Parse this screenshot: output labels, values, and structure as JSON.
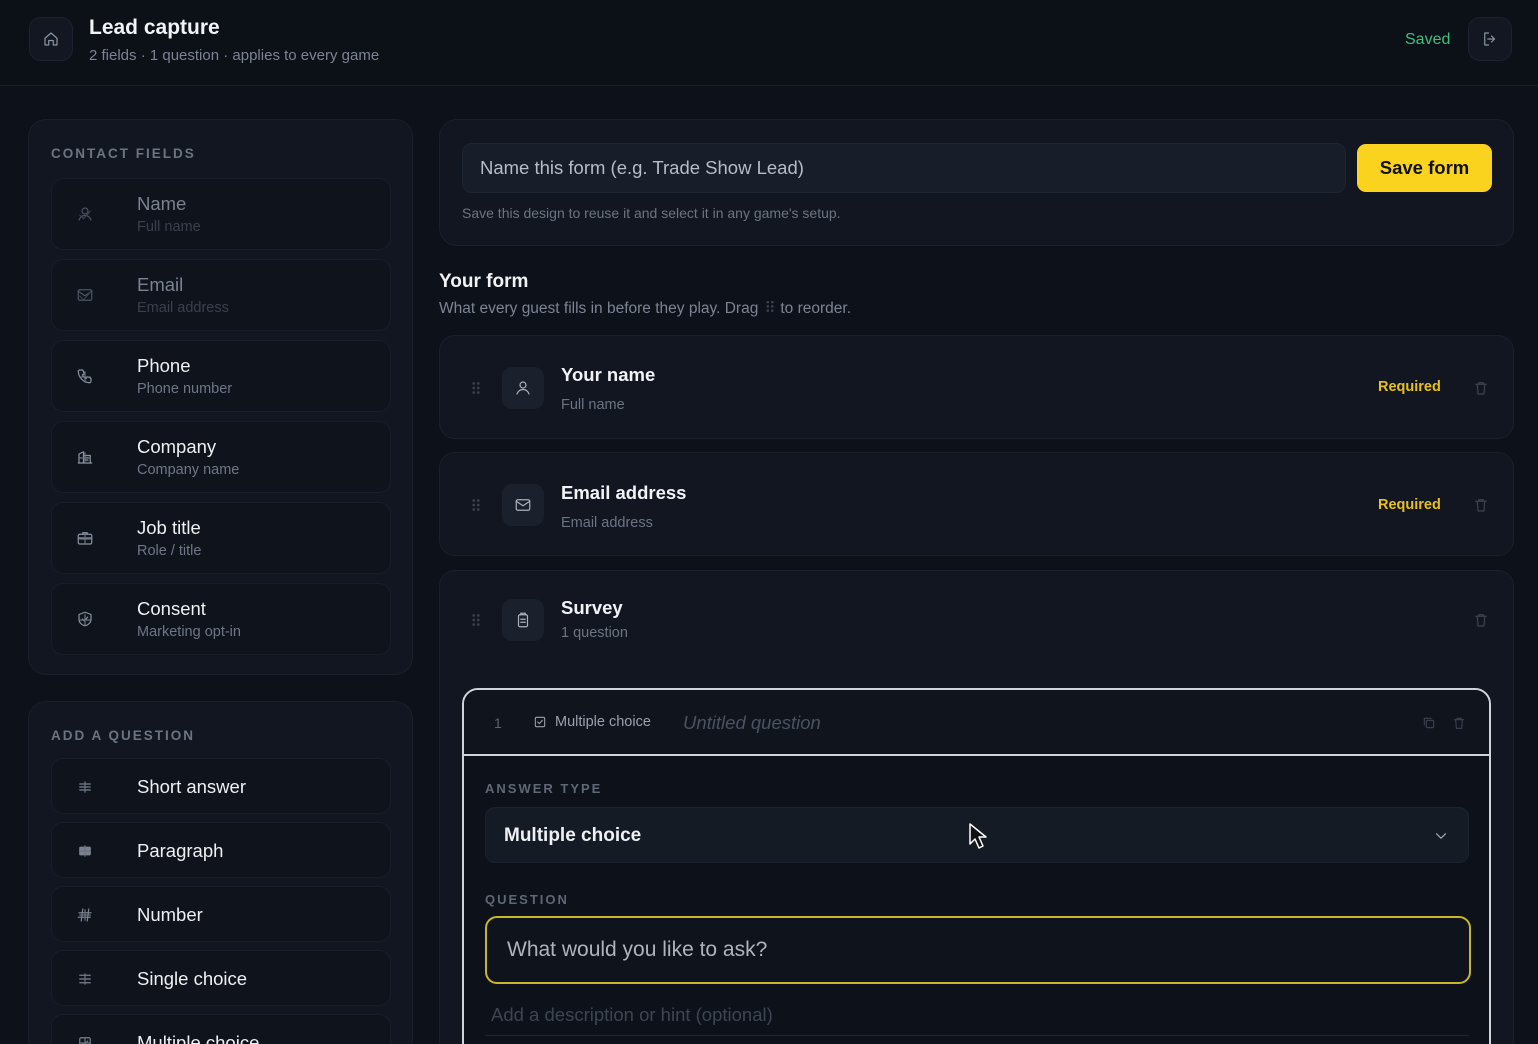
{
  "header": {
    "title": "Lead capture",
    "subtitle": "2 fields · 1 question · applies to every game",
    "status": "Saved",
    "home_icon": "home-icon",
    "exit_icon": "exit-icon"
  },
  "contact_fields": {
    "heading": "CONTACT FIELDS",
    "items": [
      {
        "label": "Name",
        "sub": "Full name",
        "icon": "user-icon",
        "state": "added"
      },
      {
        "label": "Email",
        "sub": "Email address",
        "icon": "mail-icon",
        "state": "added"
      },
      {
        "label": "Phone",
        "sub": "Phone number",
        "icon": "phone-icon",
        "state": "available"
      },
      {
        "label": "Company",
        "sub": "Company name",
        "icon": "building-icon",
        "state": "available"
      },
      {
        "label": "Job title",
        "sub": "Role / title",
        "icon": "briefcase-icon",
        "state": "available"
      },
      {
        "label": "Consent",
        "sub": "Marketing opt-in",
        "icon": "shield-check-icon",
        "state": "available"
      }
    ]
  },
  "add_question": {
    "heading": "ADD A QUESTION",
    "items": [
      {
        "label": "Short answer",
        "icon": "short-lines-icon"
      },
      {
        "label": "Paragraph",
        "icon": "paragraph-icon"
      },
      {
        "label": "Number",
        "icon": "hash-icon"
      },
      {
        "label": "Single choice",
        "icon": "list-icon"
      },
      {
        "label": "Multiple choice",
        "icon": "checkbox-icon"
      }
    ]
  },
  "form_name": {
    "placeholder": "Name this form (e.g. Trade Show Lead)",
    "save_label": "Save form",
    "hint": "Save this design to reuse it and select it in any game's setup."
  },
  "your_form": {
    "title": "Your form",
    "subtitle_before": "What every guest fills in before they play. Drag",
    "subtitle_after": "to reorder.",
    "fields": [
      {
        "label": "Your name",
        "sub": "Full name",
        "badge": "Required",
        "icon": "user-icon"
      },
      {
        "label": "Email address",
        "sub": "Email address",
        "badge": "Required",
        "icon": "mail-icon"
      },
      {
        "label": "Survey",
        "sub": "1 question",
        "badge": "",
        "icon": "clipboard-icon"
      }
    ]
  },
  "question_editor": {
    "number": "1",
    "type_tag": "Multiple choice",
    "untitled": "Untitled question",
    "answer_type_label": "ANSWER TYPE",
    "answer_type_value": "Multiple choice",
    "question_label": "QUESTION",
    "question_placeholder": "What would you like to ask?",
    "description_placeholder": "Add a description or hint (optional)"
  },
  "colors": {
    "background": "#0d1119",
    "accent": "#fad31e",
    "saved": "#3fbf7f",
    "required": "#e8c020"
  }
}
